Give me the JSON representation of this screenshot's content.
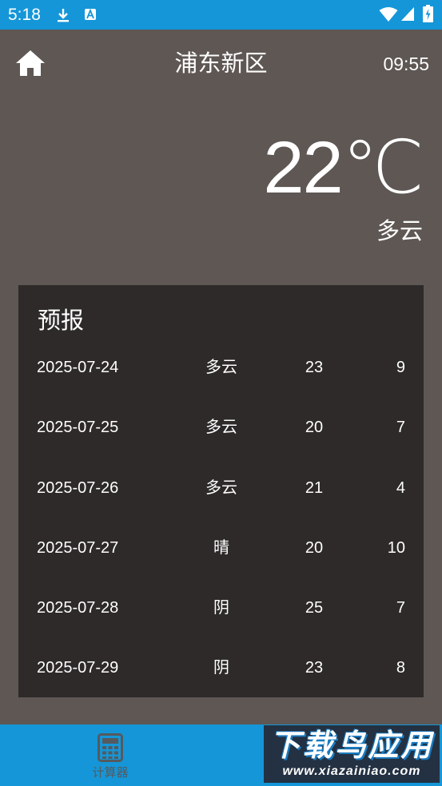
{
  "status_bar": {
    "time": "5:18",
    "icons": [
      "download-icon",
      "notification-a-icon",
      "wifi-icon",
      "signal-icon",
      "battery-charging-icon"
    ]
  },
  "header": {
    "home_icon": "home-icon",
    "location": "浦东新区",
    "update_time": "09:55"
  },
  "current": {
    "temperature": "22℃",
    "condition": "多云"
  },
  "forecast": {
    "title": "预报",
    "days": [
      {
        "date": "2025-07-24",
        "condition": "多云",
        "high": "23",
        "low": "9"
      },
      {
        "date": "2025-07-25",
        "condition": "多云",
        "high": "20",
        "low": "7"
      },
      {
        "date": "2025-07-26",
        "condition": "多云",
        "high": "21",
        "low": "4"
      },
      {
        "date": "2025-07-27",
        "condition": "晴",
        "high": "20",
        "low": "10"
      },
      {
        "date": "2025-07-28",
        "condition": "阴",
        "high": "25",
        "low": "7"
      },
      {
        "date": "2025-07-29",
        "condition": "阴",
        "high": "23",
        "low": "8"
      }
    ]
  },
  "bottom_nav": {
    "items": [
      {
        "label": "计算器",
        "icon": "calculator-icon"
      }
    ]
  },
  "watermark": {
    "title": "下载鸟应用",
    "url": "www.xiazainiao.com"
  },
  "colors": {
    "status_bar": "#1596d8",
    "background": "#5e5754",
    "card": "#2d2a29",
    "bottom_nav": "#1596d8",
    "nav_label": "#555a5e"
  }
}
